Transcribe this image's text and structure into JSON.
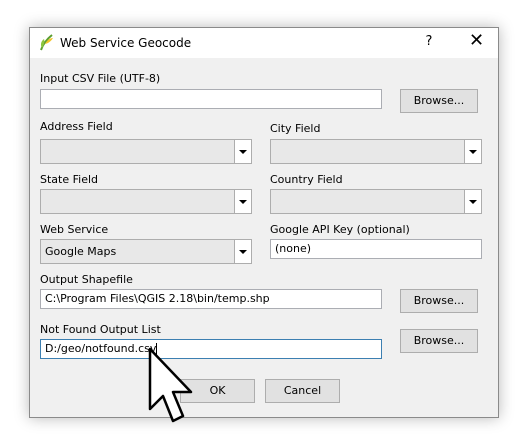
{
  "window": {
    "title": "Web Service Geocode",
    "help": "?",
    "close": "✕",
    "icon": "qgis-icon"
  },
  "input_csv": {
    "label": "Input CSV File (UTF-8)",
    "value": "",
    "browse": "Browse..."
  },
  "address_field": {
    "label": "Address Field",
    "value": ""
  },
  "city_field": {
    "label": "City Field",
    "value": ""
  },
  "state_field": {
    "label": "State Field",
    "value": ""
  },
  "country_field": {
    "label": "Country Field",
    "value": ""
  },
  "web_service": {
    "label": "Web Service",
    "value": "Google Maps"
  },
  "api_key": {
    "label": "Google API Key (optional)",
    "value": "(none)"
  },
  "output_shapefile": {
    "label": "Output Shapefile",
    "value": "C:\\Program Files\\QGIS 2.18\\bin/temp.shp",
    "browse": "Browse..."
  },
  "not_found": {
    "label": "Not Found Output List",
    "value": "D:/geo/notfound.csv",
    "browse": "Browse..."
  },
  "buttons": {
    "ok": "OK",
    "cancel": "Cancel"
  },
  "colors": {
    "focus_border": "#3c7fb1",
    "dialog_bg": "#f0f0f0"
  }
}
